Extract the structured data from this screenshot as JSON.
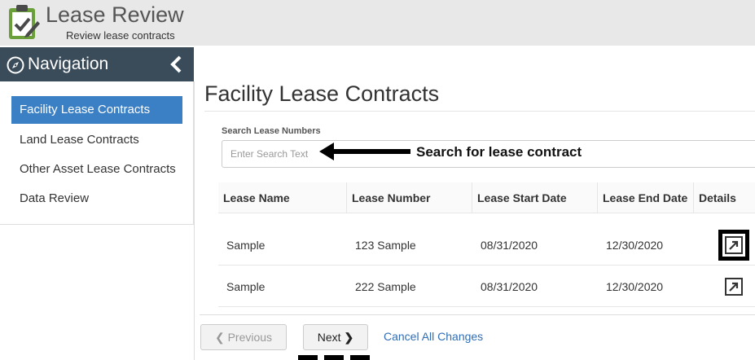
{
  "app": {
    "title": "Lease Review",
    "subtitle": "Review lease contracts",
    "logo_icon": "clipboard-check-icon"
  },
  "navigation": {
    "title": "Navigation",
    "icon": "compass-icon",
    "collapse_icon": "chevron-left-icon",
    "items": [
      {
        "label": "Facility Lease Contracts",
        "active": true
      },
      {
        "label": "Land Lease Contracts",
        "active": false
      },
      {
        "label": "Other Asset Lease Contracts",
        "active": false
      },
      {
        "label": "Data Review",
        "active": false
      }
    ]
  },
  "main": {
    "title": "Facility Lease Contracts",
    "search": {
      "label": "Search Lease Numbers",
      "placeholder": "Enter Search Text",
      "value": ""
    },
    "annotation": "Search for lease contract",
    "table": {
      "headers": [
        "Lease Name",
        "Lease Number",
        "Lease Start Date",
        "Lease End Date",
        "Details"
      ],
      "rows": [
        {
          "name": "Sample",
          "number": "123 Sample",
          "start": "08/31/2020",
          "end": "12/30/2020",
          "details_highlighted": true
        },
        {
          "name": "Sample",
          "number": "222 Sample",
          "start": "08/31/2020",
          "end": "12/30/2020",
          "details_highlighted": false
        }
      ]
    }
  },
  "footer": {
    "previous_label": "Previous",
    "next_label": "Next",
    "cancel_label": "Cancel All Changes"
  },
  "colors": {
    "header_bg": "#e8e8e8",
    "nav_bg": "#3a4b59",
    "active_item": "#3b7fc4",
    "link": "#2f6eb5"
  }
}
